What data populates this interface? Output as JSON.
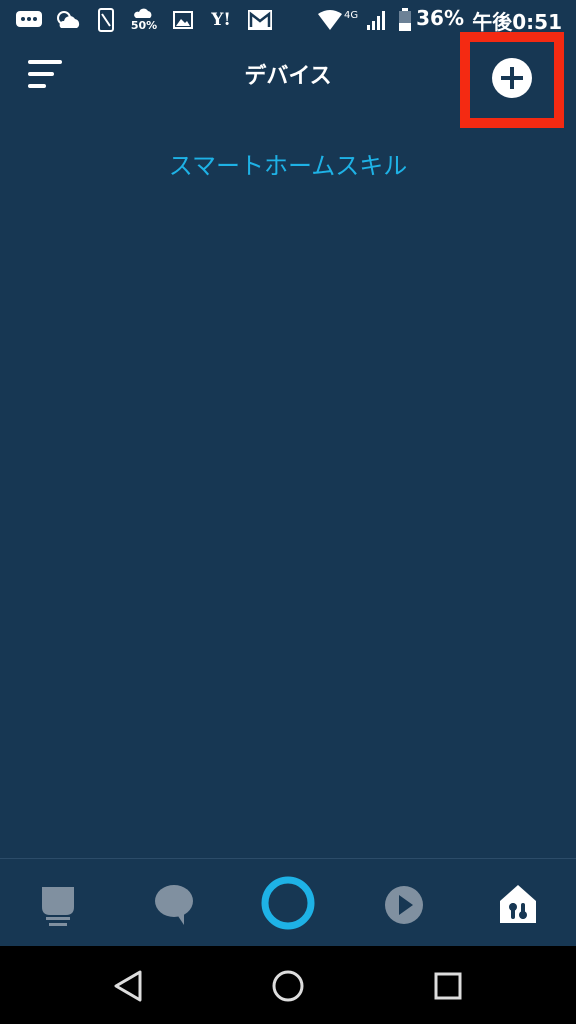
{
  "status_bar": {
    "battery_percent": "36%",
    "time": "午後0:51",
    "network": "4G",
    "weather_rain": "50%",
    "yahoo_label": "Y!"
  },
  "header": {
    "title": "デバイス"
  },
  "content": {
    "smart_home_skill_link": "スマートホームスキル"
  },
  "colors": {
    "background": "#173753",
    "accent": "#1eb2e6",
    "highlight": "#f42a12"
  },
  "bottom_nav": {
    "items": [
      "home-icon",
      "chat-icon",
      "alexa-icon",
      "play-icon",
      "devices-icon"
    ]
  }
}
